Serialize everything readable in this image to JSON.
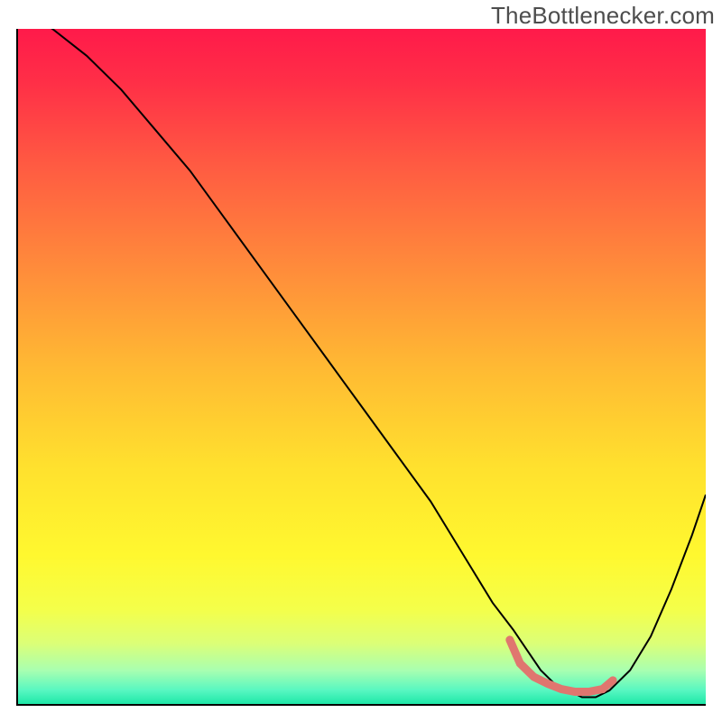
{
  "watermark": "TheBottlenecker.com",
  "chart_data": {
    "type": "line",
    "title": "",
    "xlabel": "",
    "ylabel": "",
    "xlim": [
      0,
      100
    ],
    "ylim": [
      0,
      100
    ],
    "grid": false,
    "legend": false,
    "background": {
      "type": "vertical-gradient",
      "stops": [
        {
          "pos": 0.0,
          "color": "#ff1a4a"
        },
        {
          "pos": 0.08,
          "color": "#ff2f47"
        },
        {
          "pos": 0.2,
          "color": "#ff5a42"
        },
        {
          "pos": 0.35,
          "color": "#ff8a3b"
        },
        {
          "pos": 0.5,
          "color": "#ffb933"
        },
        {
          "pos": 0.65,
          "color": "#ffe12e"
        },
        {
          "pos": 0.78,
          "color": "#fff82f"
        },
        {
          "pos": 0.86,
          "color": "#f4ff4a"
        },
        {
          "pos": 0.91,
          "color": "#dcff77"
        },
        {
          "pos": 0.95,
          "color": "#a9ffb0"
        },
        {
          "pos": 0.98,
          "color": "#57f7c1"
        },
        {
          "pos": 1.0,
          "color": "#1ee8a8"
        }
      ]
    },
    "series": [
      {
        "name": "bottleneck-curve",
        "stroke": "#000000",
        "strokeWidth": 2,
        "x": [
          0,
          5,
          10,
          15,
          20,
          25,
          30,
          35,
          40,
          45,
          50,
          55,
          60,
          63,
          66,
          69,
          72,
          74,
          76,
          78,
          80,
          82,
          84,
          86,
          89,
          92,
          95,
          98,
          100
        ],
        "y": [
          103,
          100,
          96,
          91,
          85,
          79,
          72,
          65,
          58,
          51,
          44,
          37,
          30,
          25,
          20,
          15,
          11,
          8,
          5,
          3,
          2,
          1,
          1,
          2,
          5,
          10,
          17,
          25,
          31
        ]
      },
      {
        "name": "bottleneck-safe-zone",
        "stroke": "#e0766f",
        "strokeWidth": 9,
        "linecap": "round",
        "x": [
          71.5,
          73,
          75,
          77,
          79,
          81,
          83,
          85,
          86.5
        ],
        "y": [
          9.5,
          6,
          4,
          3,
          2.2,
          1.8,
          1.8,
          2.2,
          3.5
        ]
      }
    ]
  }
}
